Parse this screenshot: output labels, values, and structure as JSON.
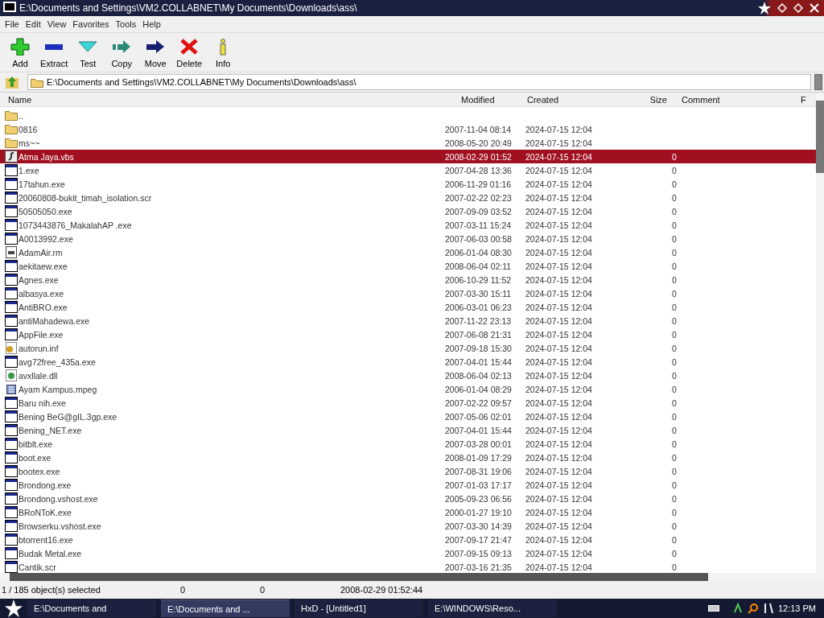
{
  "window": {
    "title": "E:\\Documents and Settings\\VM2.COLLABNET\\My Documents\\Downloads\\ass\\"
  },
  "menu": [
    "File",
    "Edit",
    "View",
    "Favorites",
    "Tools",
    "Help"
  ],
  "toolbar": [
    {
      "label": "Add",
      "kind": "add"
    },
    {
      "label": "Extract",
      "kind": "extract"
    },
    {
      "label": "Test",
      "kind": "test"
    },
    {
      "label": "Copy",
      "kind": "copy"
    },
    {
      "label": "Move",
      "kind": "move"
    },
    {
      "label": "Delete",
      "kind": "delete"
    },
    {
      "label": "Info",
      "kind": "info"
    }
  ],
  "address": "E:\\Documents and Settings\\VM2.COLLABNET\\My Documents\\Downloads\\ass\\",
  "columns": [
    "Name",
    "Modified",
    "Created",
    "Size",
    "Comment",
    "F"
  ],
  "rows": [
    {
      "name": "..",
      "kind": "folder",
      "selected": false
    },
    {
      "name": "0816",
      "modified": "2007-11-04 08:14",
      "created": "2024-07-15 12:04",
      "kind": "folder",
      "selected": false
    },
    {
      "name": "ms~~",
      "modified": "2008-05-20 20:49",
      "created": "2024-07-15 12:04",
      "kind": "folder",
      "selected": false
    },
    {
      "name": "Atma Jaya.vbs",
      "modified": "2008-02-29 01:52",
      "created": "2024-07-15 12:04",
      "size": "0",
      "kind": "script",
      "selected": true
    },
    {
      "name": "1.exe",
      "modified": "2007-04-28 13:36",
      "created": "2024-07-15 12:04",
      "size": "0",
      "kind": "exe",
      "selected": false
    },
    {
      "name": "17tahun.exe",
      "modified": "2006-11-29 01:16",
      "created": "2024-07-15 12:04",
      "size": "0",
      "kind": "exe",
      "selected": false
    },
    {
      "name": "20060808-bukit_timah_isolation.scr",
      "modified": "2007-02-22 02:23",
      "created": "2024-07-15 12:04",
      "size": "0",
      "kind": "exe",
      "selected": false
    },
    {
      "name": "50505050.exe",
      "modified": "2007-09-09 03:52",
      "created": "2024-07-15 12:04",
      "size": "0",
      "kind": "exe",
      "selected": false
    },
    {
      "name": "1073443876_MakalahAP .exe",
      "modified": "2007-03-11 15:24",
      "created": "2024-07-15 12:04",
      "size": "0",
      "kind": "exe",
      "selected": false
    },
    {
      "name": "A0013992.exe",
      "modified": "2007-06-03 00:58",
      "created": "2024-07-15 12:04",
      "size": "0",
      "kind": "exe",
      "selected": false
    },
    {
      "name": "AdamAir.rm",
      "modified": "2006-01-04 08:30",
      "created": "2024-07-15 12:04",
      "size": "0",
      "kind": "media",
      "selected": false
    },
    {
      "name": "aekitaew.exe",
      "modified": "2008-06-04 02:11",
      "created": "2024-07-15 12:04",
      "size": "0",
      "kind": "exe",
      "selected": false
    },
    {
      "name": "Agnes.exe",
      "modified": "2006-10-29 11:52",
      "created": "2024-07-15 12:04",
      "size": "0",
      "kind": "exe",
      "selected": false
    },
    {
      "name": "albasya.exe",
      "modified": "2007-03-30 15:11",
      "created": "2024-07-15 12:04",
      "size": "0",
      "kind": "exe",
      "selected": false
    },
    {
      "name": "AntiBRO.exe",
      "modified": "2006-03-01 06:23",
      "created": "2024-07-15 12:04",
      "size": "0",
      "kind": "exe",
      "selected": false
    },
    {
      "name": "antiMahadewa.exe",
      "modified": "2007-11-22 23:13",
      "created": "2024-07-15 12:04",
      "size": "0",
      "kind": "exe",
      "selected": false
    },
    {
      "name": "AppFile.exe",
      "modified": "2007-06-08 21:31",
      "created": "2024-07-15 12:04",
      "size": "0",
      "kind": "exe",
      "selected": false
    },
    {
      "name": "autorun.inf",
      "modified": "2007-09-18 15:30",
      "created": "2024-07-15 12:04",
      "size": "0",
      "kind": "settings",
      "selected": false
    },
    {
      "name": "avg72free_435a.exe",
      "modified": "2007-04-01 15:44",
      "created": "2024-07-15 12:04",
      "size": "0",
      "kind": "exe",
      "selected": false
    },
    {
      "name": "avxllale.dll",
      "modified": "2008-06-04 02:13",
      "created": "2024-07-15 12:04",
      "size": "0",
      "kind": "library",
      "selected": false
    },
    {
      "name": "Ayam Kampus.mpeg",
      "modified": "2006-01-04 08:29",
      "created": "2024-07-15 12:04",
      "size": "0",
      "kind": "video",
      "selected": false
    },
    {
      "name": "Baru nih.exe",
      "modified": "2007-02-22 09:57",
      "created": "2024-07-15 12:04",
      "size": "0",
      "kind": "exe",
      "selected": false
    },
    {
      "name": "Bening BeG@gIL.3gp.exe",
      "modified": "2007-05-06 02:01",
      "created": "2024-07-15 12:04",
      "size": "0",
      "kind": "exe",
      "selected": false
    },
    {
      "name": "Bening_NET.exe",
      "modified": "2007-04-01 15:44",
      "created": "2024-07-15 12:04",
      "size": "0",
      "kind": "exe",
      "selected": false
    },
    {
      "name": "bitblt.exe",
      "modified": "2007-03-28 00:01",
      "created": "2024-07-15 12:04",
      "size": "0",
      "kind": "exe",
      "selected": false
    },
    {
      "name": "boot.exe",
      "modified": "2008-01-09 17:29",
      "created": "2024-07-15 12:04",
      "size": "0",
      "kind": "exe",
      "selected": false
    },
    {
      "name": "bootex.exe",
      "modified": "2007-08-31 19:06",
      "created": "2024-07-15 12:04",
      "size": "0",
      "kind": "exe",
      "selected": false
    },
    {
      "name": "Brondong.exe",
      "modified": "2007-01-03 17:17",
      "created": "2024-07-15 12:04",
      "size": "0",
      "kind": "exe",
      "selected": false
    },
    {
      "name": "Brondong.vshost.exe",
      "modified": "2005-09-23 06:56",
      "created": "2024-07-15 12:04",
      "size": "0",
      "kind": "exe",
      "selected": false
    },
    {
      "name": "BRoNToK.exe",
      "modified": "2000-01-27 19:10",
      "created": "2024-07-15 12:04",
      "size": "0",
      "kind": "exe",
      "selected": false
    },
    {
      "name": "Browserku.vshost.exe",
      "modified": "2007-03-30 14:39",
      "created": "2024-07-15 12:04",
      "size": "0",
      "kind": "exe",
      "selected": false
    },
    {
      "name": "btorrent16.exe",
      "modified": "2007-09-17 21:47",
      "created": "2024-07-15 12:04",
      "size": "0",
      "kind": "exe",
      "selected": false
    },
    {
      "name": "Budak Metal.exe",
      "modified": "2007-09-15 09:13",
      "created": "2024-07-15 12:04",
      "size": "0",
      "kind": "exe",
      "selected": false
    },
    {
      "name": "Cantik.scr",
      "modified": "2007-03-16 21:35",
      "created": "2024-07-15 12:04",
      "size": "0",
      "kind": "exe",
      "selected": false
    }
  ],
  "status_bar": [
    "1 / 185 object(s) selected",
    "0",
    "0",
    "2008-02-29 01:52:44"
  ],
  "taskbar": {
    "tasks": [
      {
        "label": "E:\\Documents and",
        "selected": false
      },
      {
        "label": "E:\\Documents and ...",
        "selected": true
      },
      {
        "label": "HxD - [Untitled1]",
        "selected": false
      },
      {
        "label": "E:\\WINDOWS\\Reso...",
        "selected": false
      }
    ],
    "clock": "12:13 PM"
  }
}
